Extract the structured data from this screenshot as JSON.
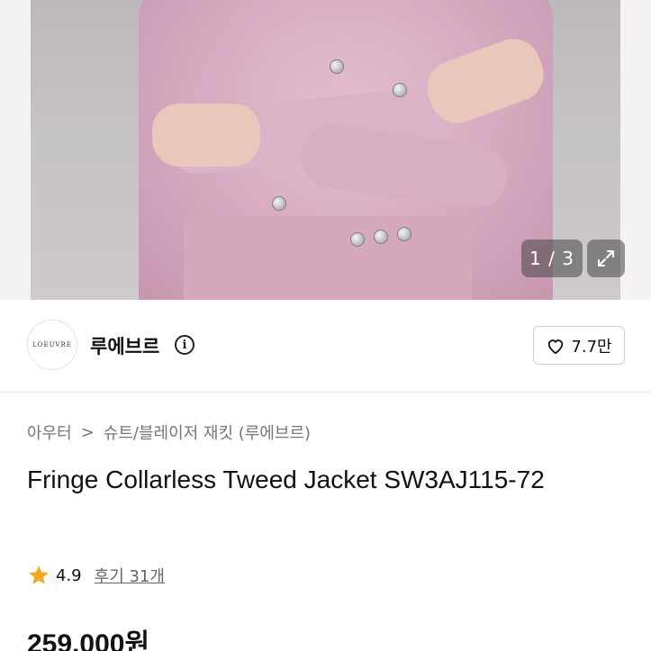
{
  "gallery": {
    "counter": "1 / 3",
    "expand_icon": "expand-icon"
  },
  "seller": {
    "logo_text": "LOEUVRE",
    "name": "루에브르",
    "info_icon": "info-icon",
    "like_icon": "heart-icon",
    "like_count": "7.7만"
  },
  "product": {
    "breadcrumb": [
      "아우터",
      "슈트/블레이저 재킷 (루에브르)"
    ],
    "breadcrumb_separator": ">",
    "title": "Fringe Collarless Tweed Jacket SW3AJ115-72",
    "rating": {
      "star_icon": "star-icon",
      "star_color": "#f5a623",
      "score": "4.9",
      "reviews": "후기 31개"
    },
    "price": "259,000원"
  }
}
